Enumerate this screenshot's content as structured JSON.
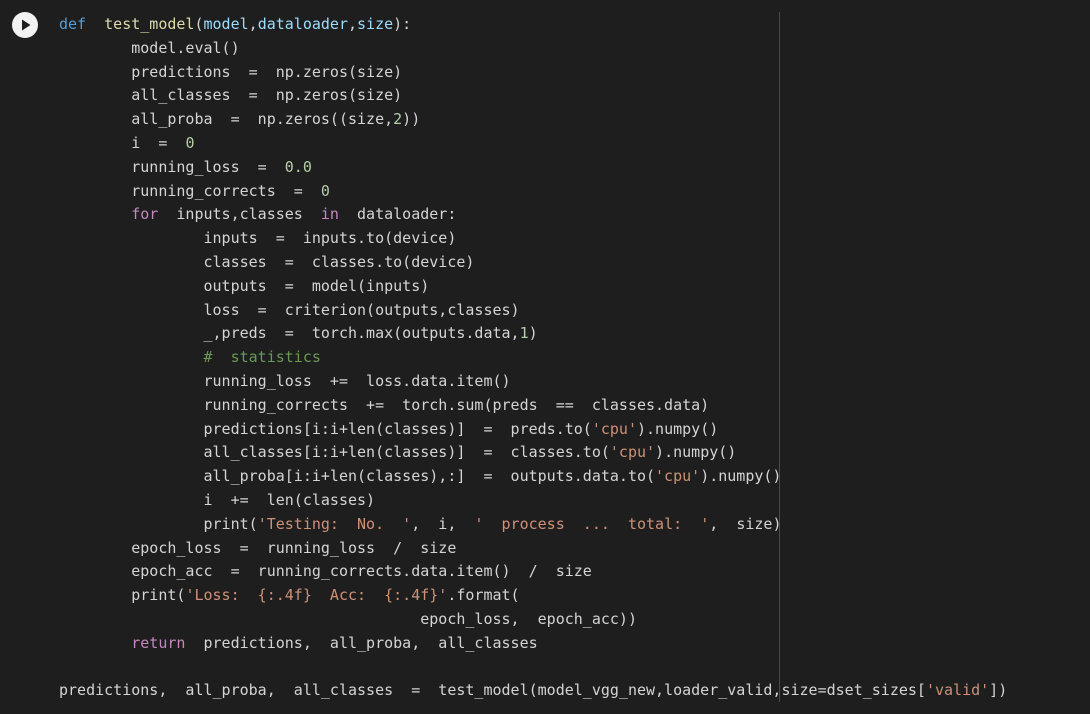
{
  "cell": {
    "run_button_icon": "play-icon",
    "lines": [
      [
        {
          "t": "def",
          "c": "def"
        },
        {
          "t": "  "
        },
        {
          "t": "test_model",
          "c": "fn"
        },
        {
          "t": "("
        },
        {
          "t": "model",
          "c": "var"
        },
        {
          "t": ","
        },
        {
          "t": "dataloader",
          "c": "var"
        },
        {
          "t": ","
        },
        {
          "t": "size",
          "c": "var"
        },
        {
          "t": "):"
        }
      ],
      [
        {
          "t": "        model.eval()"
        }
      ],
      [
        {
          "t": "        predictions  =  np.zeros(size)"
        }
      ],
      [
        {
          "t": "        all_classes  =  np.zeros(size)"
        }
      ],
      [
        {
          "t": "        all_proba  =  np.zeros((size,"
        },
        {
          "t": "2",
          "c": "num"
        },
        {
          "t": "))"
        }
      ],
      [
        {
          "t": "        i  =  "
        },
        {
          "t": "0",
          "c": "num"
        }
      ],
      [
        {
          "t": "        running_loss  =  "
        },
        {
          "t": "0.0",
          "c": "num"
        }
      ],
      [
        {
          "t": "        running_corrects  =  "
        },
        {
          "t": "0",
          "c": "num"
        }
      ],
      [
        {
          "t": "        "
        },
        {
          "t": "for",
          "c": "kw"
        },
        {
          "t": "  inputs,classes  "
        },
        {
          "t": "in",
          "c": "kw"
        },
        {
          "t": "  dataloader:"
        }
      ],
      [
        {
          "t": "                inputs  =  inputs.to(device)"
        }
      ],
      [
        {
          "t": "                classes  =  classes.to(device)"
        }
      ],
      [
        {
          "t": "                outputs  =  model(inputs)"
        }
      ],
      [
        {
          "t": "                loss  =  criterion(outputs,classes)"
        }
      ],
      [
        {
          "t": "                _,preds  =  torch.max(outputs.data,"
        },
        {
          "t": "1",
          "c": "num"
        },
        {
          "t": ")"
        }
      ],
      [
        {
          "t": "                "
        },
        {
          "t": "#  statistics",
          "c": "com"
        }
      ],
      [
        {
          "t": "                running_loss  +=  loss.data.item()"
        }
      ],
      [
        {
          "t": "                running_corrects  +=  torch.sum(preds  ==  classes.data)"
        }
      ],
      [
        {
          "t": "                predictions[i:i+len(classes)]  =  preds.to("
        },
        {
          "t": "'cpu'",
          "c": "str"
        },
        {
          "t": ").numpy()"
        }
      ],
      [
        {
          "t": "                all_classes[i:i+len(classes)]  =  classes.to("
        },
        {
          "t": "'cpu'",
          "c": "str"
        },
        {
          "t": ").numpy()"
        }
      ],
      [
        {
          "t": "                all_proba[i:i+len(classes),:]  =  outputs.data.to("
        },
        {
          "t": "'cpu'",
          "c": "str"
        },
        {
          "t": ").numpy()"
        }
      ],
      [
        {
          "t": "                i  +=  len(classes)"
        }
      ],
      [
        {
          "t": "                print("
        },
        {
          "t": "'Testing:  No.  '",
          "c": "str"
        },
        {
          "t": ",  i,  "
        },
        {
          "t": "'  process  ...  total:  '",
          "c": "str"
        },
        {
          "t": ",  size)"
        }
      ],
      [
        {
          "t": "        epoch_loss  =  running_loss  /  size"
        }
      ],
      [
        {
          "t": "        epoch_acc  =  running_corrects.data.item()  /  size"
        }
      ],
      [
        {
          "t": "        print("
        },
        {
          "t": "'Loss:  {:.4f}  Acc:  {:.4f}'",
          "c": "str"
        },
        {
          "t": ".format("
        }
      ],
      [
        {
          "t": "                                        epoch_loss,  epoch_acc))"
        }
      ],
      [
        {
          "t": "        "
        },
        {
          "t": "return",
          "c": "kw"
        },
        {
          "t": "  predictions,  all_proba,  all_classes"
        }
      ],
      [
        {
          "t": ""
        }
      ],
      [
        {
          "t": "predictions,  all_proba,  all_classes  =  test_model(model_vgg_new,loader_valid,size=dset_sizes["
        },
        {
          "t": "'valid'",
          "c": "str"
        },
        {
          "t": "])"
        }
      ]
    ]
  }
}
